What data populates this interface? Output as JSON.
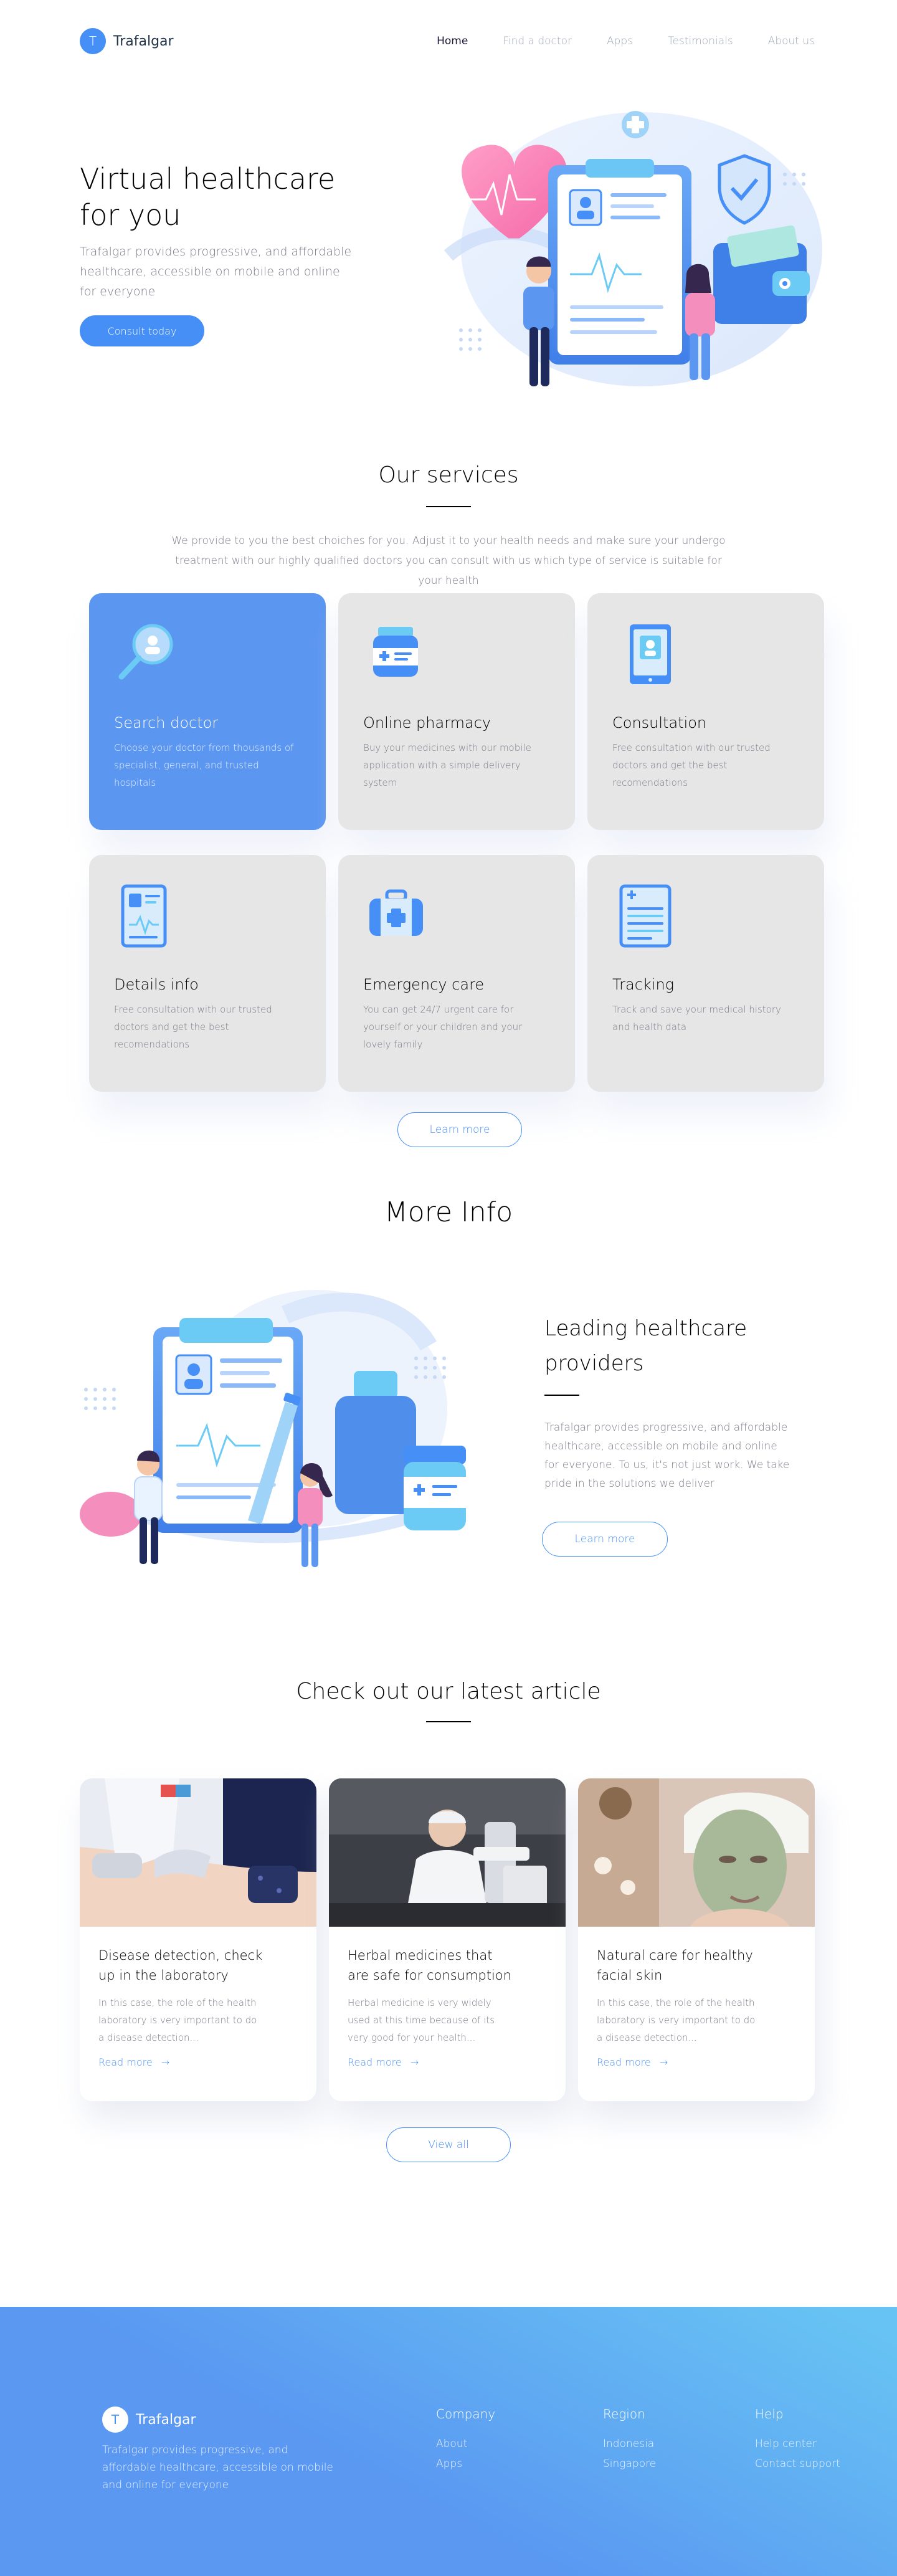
{
  "brand": {
    "logo_letter": "T",
    "name": "Trafalgar"
  },
  "nav": {
    "items": [
      {
        "label": "Home"
      },
      {
        "label": "Find a doctor"
      },
      {
        "label": "Apps"
      },
      {
        "label": "Testimonials"
      },
      {
        "label": "About us"
      }
    ]
  },
  "hero": {
    "title": "Virtual healthcare for you",
    "description": "Trafalgar provides progressive, and affordable healthcare, accessible on mobile and online for everyone",
    "cta": "Consult today"
  },
  "services": {
    "title": "Our services",
    "description": "We provide to you the best choiches for you. Adjust it to your health needs and make sure your undergo treatment with our highly qualified doctors you can consult with us which type of service is suitable for your health",
    "cards": [
      {
        "icon": "search-doctor-icon",
        "title": "Search doctor",
        "text": "Choose your doctor from thousands of specialist, general, and trusted hospitals"
      },
      {
        "icon": "pharmacy-bottle-icon",
        "title": "Online pharmacy",
        "text": "Buy  your medicines with our mobile application with a simple delivery system"
      },
      {
        "icon": "consultation-tablet-icon",
        "title": "Consultation",
        "text": "Free consultation with our trusted doctors and get the best recomendations"
      },
      {
        "icon": "details-report-icon",
        "title": "Details info",
        "text": "Free consultation with our trusted doctors and get the best recomendations"
      },
      {
        "icon": "emergency-kit-icon",
        "title": "Emergency care",
        "text": "You can get 24/7 urgent care for yourself or your children and your lovely family"
      },
      {
        "icon": "tracking-clipboard-icon",
        "title": "Tracking",
        "text": "Track and save your medical history and health data"
      }
    ],
    "learn_more": "Learn more"
  },
  "more_info": {
    "title": "More Info",
    "heading": "Leading healthcare providers",
    "description": "Trafalgar provides progressive, and affordable healthcare, accessible on mobile and online for everyone. To us, it's not just work. We take pride in the solutions we deliver",
    "button": "Learn more"
  },
  "articles": {
    "title": "Check out our latest article",
    "items": [
      {
        "title": "Disease detection, check up in the laboratory",
        "text": "In this case, the role of the health laboratory is very important to do a disease detection...",
        "link": "Read more"
      },
      {
        "title": "Herbal medicines that are safe for consumption",
        "text": "Herbal medicine is very widely used at this time because of its very good for your health...",
        "link": "Read more"
      },
      {
        "title": "Natural care for healthy facial skin",
        "text": "In this case, the role of the health laboratory is very important to do a disease detection...",
        "link": "Read more"
      }
    ],
    "view_all": "View all"
  },
  "footer": {
    "logo_letter": "T",
    "name": "Trafalgar",
    "description": "Trafalgar provides progressive, and affordable healthcare, accessible on mobile and online for everyone",
    "columns": [
      {
        "title": "Company",
        "links": [
          "About",
          "Apps"
        ]
      },
      {
        "title": "Region",
        "links": [
          "Indonesia",
          "Singapore"
        ]
      },
      {
        "title": "Help",
        "links": [
          "Help center",
          "Contact support"
        ]
      }
    ]
  },
  "colors": {
    "primary": "#458FF6",
    "card": "#E6E6E6",
    "text_muted": "#7D7987"
  }
}
